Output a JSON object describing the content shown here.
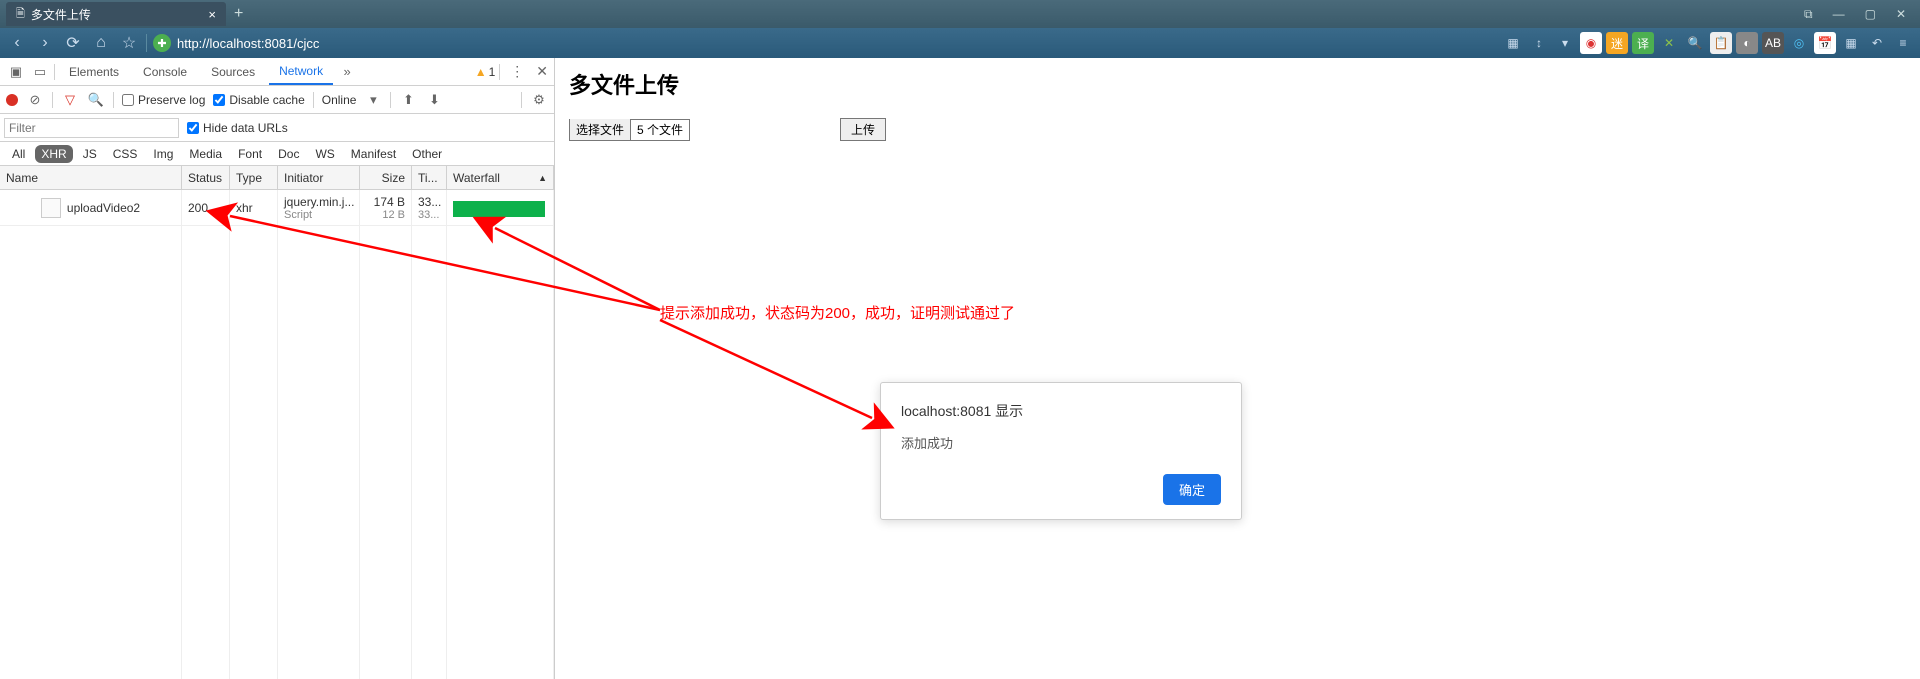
{
  "browser": {
    "tab_title": "多文件上传",
    "url": "http://localhost:8081/cjcc"
  },
  "devtools": {
    "tabs": {
      "elements": "Elements",
      "console": "Console",
      "sources": "Sources",
      "network": "Network"
    },
    "warn_count": "1",
    "toolbar": {
      "preserve_log": "Preserve log",
      "disable_cache": "Disable cache",
      "throttle": "Online"
    },
    "filter_placeholder": "Filter",
    "hide_urls": "Hide data URLs",
    "types": {
      "all": "All",
      "xhr": "XHR",
      "js": "JS",
      "css": "CSS",
      "img": "Img",
      "media": "Media",
      "font": "Font",
      "doc": "Doc",
      "ws": "WS",
      "manifest": "Manifest",
      "other": "Other"
    },
    "head": {
      "name": "Name",
      "status": "Status",
      "type": "Type",
      "initiator": "Initiator",
      "size": "Size",
      "time": "Ti...",
      "waterfall": "Waterfall"
    },
    "row": {
      "name": "uploadVideo2",
      "status": "200",
      "type": "xhr",
      "initiator": "jquery.min.j...",
      "initiator_sub": "Script",
      "size": "174 B",
      "size_sub": "12 B",
      "time": "33...",
      "time_sub": "33..."
    }
  },
  "page": {
    "heading": "多文件上传",
    "choose_btn": "选择文件",
    "file_count": "5 个文件",
    "upload_btn": "上传"
  },
  "annotation": "提示添加成功，状态码为200，成功，证明测试通过了",
  "alert": {
    "title": "localhost:8081 显示",
    "message": "添加成功",
    "ok": "确定"
  }
}
